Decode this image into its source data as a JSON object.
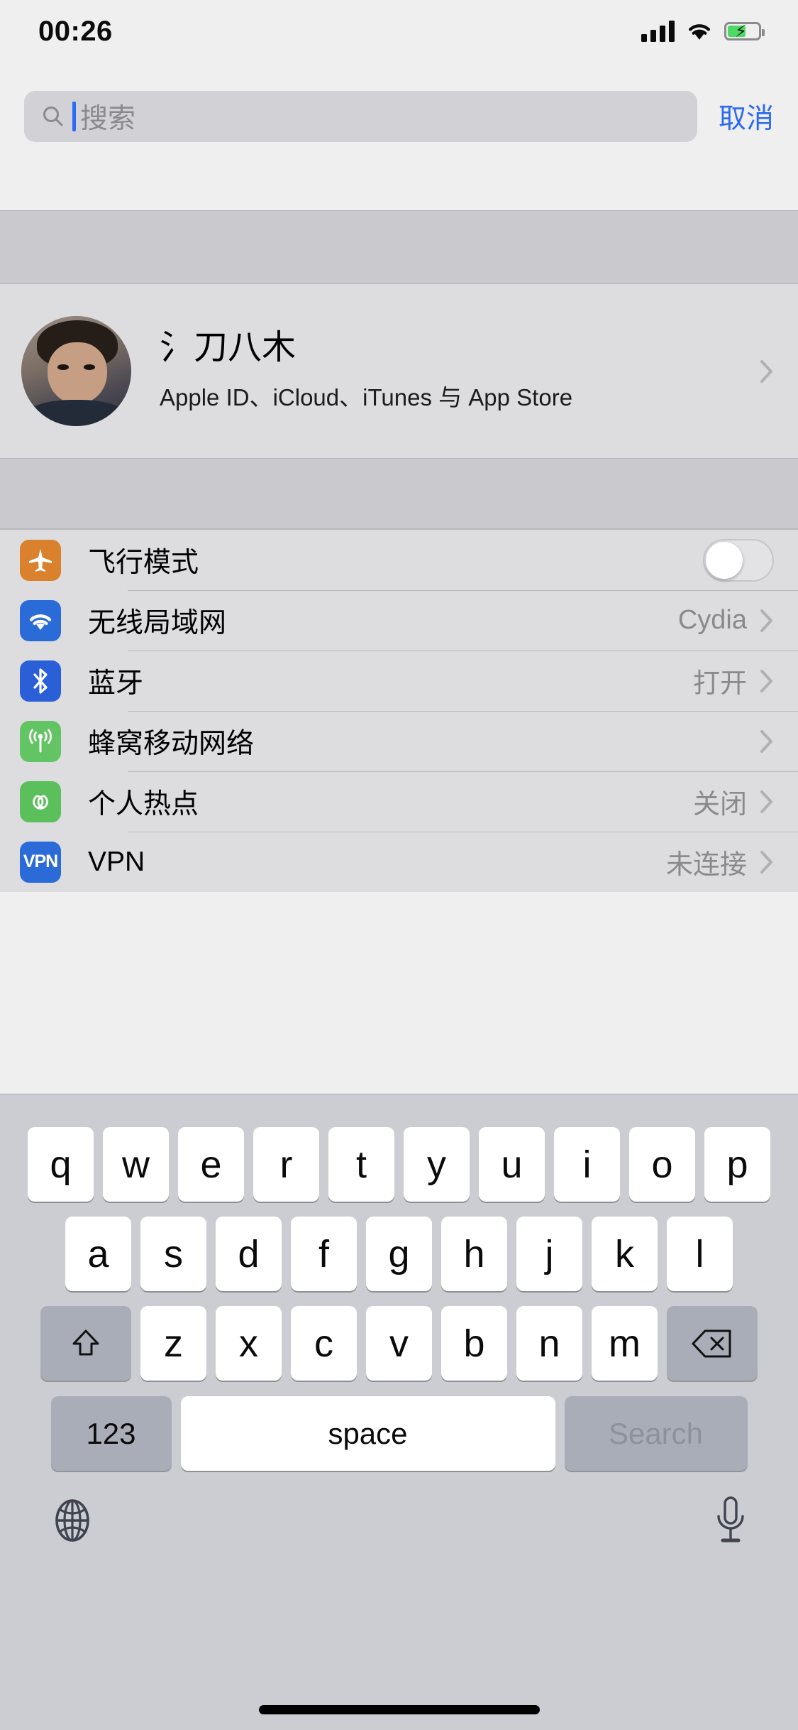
{
  "status_bar": {
    "time": "00:26",
    "signal_icon": "cellular-bars-icon",
    "wifi_icon": "wifi-icon",
    "battery_icon": "battery-charging-icon",
    "battery_charging": true
  },
  "search": {
    "placeholder": "搜索",
    "value": "",
    "icon": "search-icon",
    "cancel_label": "取消"
  },
  "profile": {
    "name": "氵刀八木",
    "subtitle": "Apple ID、iCloud、iTunes 与 App Store",
    "avatar_name": "user-avatar",
    "chevron": "chevron-right-icon"
  },
  "settings_rows": [
    {
      "label": "飞行模式",
      "icon": "airplane-icon",
      "control": "toggle",
      "value": "",
      "toggle_on": false
    },
    {
      "label": "无线局域网",
      "icon": "wifi-icon",
      "control": "chevron",
      "value": "Cydia"
    },
    {
      "label": "蓝牙",
      "icon": "bluetooth-icon",
      "control": "chevron",
      "value": "打开"
    },
    {
      "label": "蜂窝移动网络",
      "icon": "cellular-icon",
      "control": "chevron",
      "value": ""
    },
    {
      "label": "个人热点",
      "icon": "hotspot-icon",
      "control": "chevron",
      "value": "关闭"
    },
    {
      "label": "VPN",
      "icon": "vpn-icon",
      "control": "chevron",
      "value": "未连接"
    }
  ],
  "keyboard": {
    "row1": [
      "q",
      "w",
      "e",
      "r",
      "t",
      "y",
      "u",
      "i",
      "o",
      "p"
    ],
    "row2": [
      "a",
      "s",
      "d",
      "f",
      "g",
      "h",
      "j",
      "k",
      "l"
    ],
    "row3": [
      "z",
      "x",
      "c",
      "v",
      "b",
      "n",
      "m"
    ],
    "shift_icon": "shift-arrow-icon",
    "delete_icon": "delete-backspace-icon",
    "numbers_label": "123",
    "space_label": "space",
    "return_label": "Search",
    "globe_icon": "globe-icon",
    "mic_icon": "microphone-icon"
  },
  "colors": {
    "accent_blue": "#2b6af3",
    "airplane_orange": "#d9812c",
    "wifi_blue": "#2a6bd8",
    "cellular_green": "#62c462",
    "battery_green": "#4cd964",
    "keyboard_bg": "#cbcdd3"
  }
}
